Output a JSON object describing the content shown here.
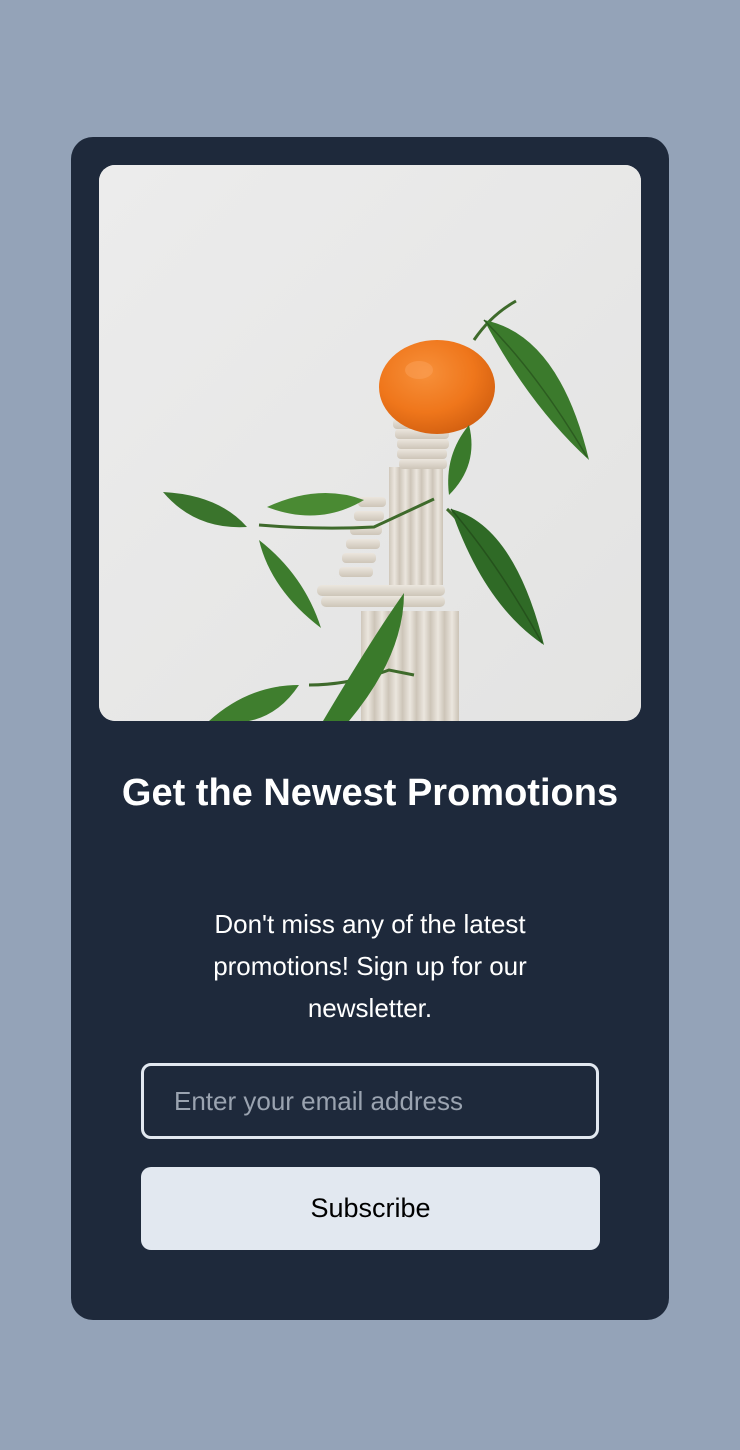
{
  "colors": {
    "page_background": "#94a3b8",
    "card_background": "#1e293b",
    "button_background": "#e2e8f0",
    "input_border": "#e2e8f0",
    "orange": "#f07a1e",
    "leaf": "#3f7a2e"
  },
  "hero": {
    "image_subject": "mandarin orange with leaves on a stacked clay sculpture"
  },
  "newsletter": {
    "title": "Get the Newest Promotions",
    "description": "Don't miss any of the latest promotions! Sign up for our newsletter.",
    "email_placeholder": "Enter your email address",
    "email_value": "",
    "subscribe_label": "Subscribe"
  }
}
